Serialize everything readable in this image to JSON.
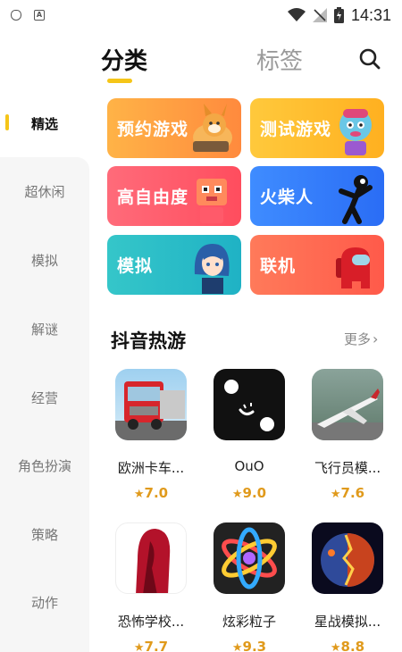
{
  "status_bar": {
    "time": "14:31"
  },
  "tabs": {
    "category": "分类",
    "tags": "标签"
  },
  "sidebar": {
    "items": [
      {
        "label": "精选",
        "active": true
      },
      {
        "label": "超休闲"
      },
      {
        "label": "模拟"
      },
      {
        "label": "解谜"
      },
      {
        "label": "经营"
      },
      {
        "label": "角色扮演"
      },
      {
        "label": "策略"
      },
      {
        "label": "动作"
      }
    ]
  },
  "categories": [
    {
      "label": "预约游戏",
      "color_start": "#ffb347",
      "color_end": "#ff8a3d"
    },
    {
      "label": "测试游戏",
      "color_start": "#ffc93c",
      "color_end": "#ffb020"
    },
    {
      "label": "高自由度",
      "color_start": "#ff6b7a",
      "color_end": "#ff4d5e"
    },
    {
      "label": "火柴人",
      "color_start": "#3f8cff",
      "color_end": "#2a6df5"
    },
    {
      "label": "模拟",
      "color_start": "#35c6c9",
      "color_end": "#1fb2c5"
    },
    {
      "label": "联机",
      "color_start": "#ff7a5a",
      "color_end": "#ff5a4a"
    }
  ],
  "section": {
    "title": "抖音热游",
    "more": "更多"
  },
  "games": [
    {
      "name": "欧洲卡车...",
      "rating": "7.0",
      "icon": "truck-icon"
    },
    {
      "name": "OuO",
      "rating": "9.0",
      "icon": "dice-icon"
    },
    {
      "name": "飞行员模...",
      "rating": "7.6",
      "icon": "airplane-icon"
    },
    {
      "name": "恐怖学校...",
      "rating": "7.7",
      "icon": "horror-girl-icon"
    },
    {
      "name": "炫彩粒子",
      "rating": "9.3",
      "icon": "atom-icon"
    },
    {
      "name": "星战模拟...",
      "rating": "8.8",
      "icon": "planet-icon"
    }
  ]
}
